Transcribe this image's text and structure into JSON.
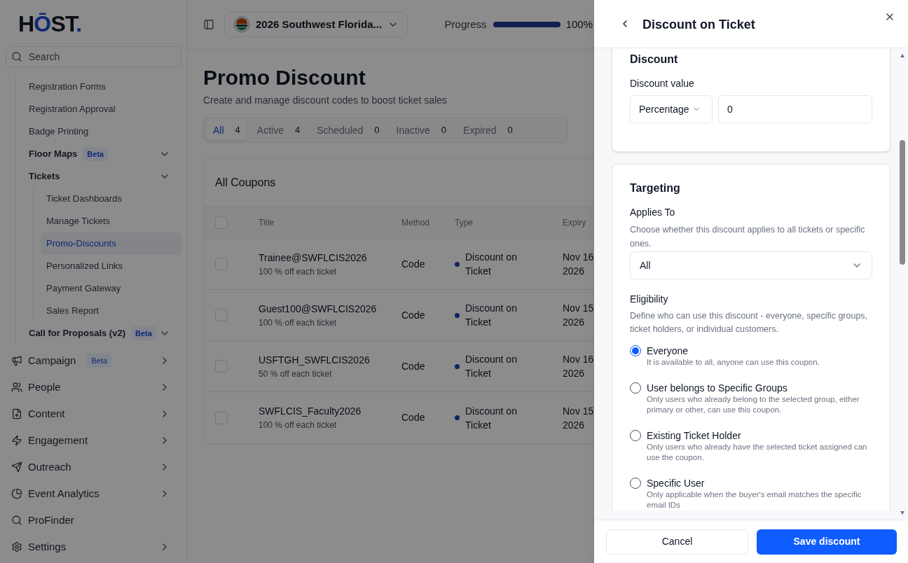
{
  "logo": [
    {
      "text": "H",
      "accent": false
    },
    {
      "text": "Ō",
      "accent": true
    },
    {
      "text": "ST",
      "accent": false
    },
    {
      "text": ".",
      "accent": true
    }
  ],
  "search": {
    "placeholder": "Search"
  },
  "sidebar": {
    "nested_items": [
      {
        "label": "Registration Forms",
        "selected": false
      },
      {
        "label": "Registration Approval",
        "selected": false
      },
      {
        "label": "Badge Printing",
        "selected": false
      },
      {
        "label": "Floor Maps",
        "badge": "Beta",
        "selected": false
      },
      {
        "label": "Tickets",
        "selected": false,
        "children": [
          {
            "label": "Ticket Dashboards",
            "selected": false
          },
          {
            "label": "Manage Tickets",
            "selected": false
          },
          {
            "label": "Promo-Discounts",
            "selected": true
          },
          {
            "label": "Personalized Links",
            "selected": false
          },
          {
            "label": "Payment Gateway",
            "selected": false
          },
          {
            "label": "Sales Report",
            "selected": false
          }
        ]
      },
      {
        "label": "Call for Proposals (v2)",
        "badge": "Beta",
        "selected": false
      }
    ],
    "items": [
      {
        "label": "Campaign",
        "badge": "Beta",
        "has_submenu": true,
        "selected": false
      },
      {
        "label": "People",
        "has_submenu": true,
        "selected": false
      },
      {
        "label": "Content",
        "has_submenu": true,
        "selected": false
      },
      {
        "label": "Engagement",
        "has_submenu": true,
        "selected": false
      },
      {
        "label": "Outreach",
        "has_submenu": true,
        "selected": false
      },
      {
        "label": "Event Analytics",
        "has_submenu": true,
        "selected": false
      },
      {
        "label": "ProFinder",
        "has_submenu": false,
        "selected": false
      },
      {
        "label": "Settings",
        "has_submenu": true,
        "selected": false
      }
    ]
  },
  "header": {
    "event": "2026 Southwest Florida...",
    "progress": {
      "label": "Progress",
      "level": 1,
      "reading": "100%"
    }
  },
  "page": {
    "title": "Promo Discount",
    "subtitle": "Create and manage discount codes to boost ticket sales"
  },
  "tabs": [
    {
      "label": "All",
      "count": "4",
      "selected": true
    },
    {
      "label": "Active",
      "count": "4",
      "selected": false
    },
    {
      "label": "Scheduled",
      "count": "0",
      "selected": false
    },
    {
      "label": "Inactive",
      "count": "0",
      "selected": false
    },
    {
      "label": "Expired",
      "count": "0",
      "selected": false
    }
  ],
  "table": {
    "title": "All Coupons",
    "all_checked": false,
    "columns": [
      "Title",
      "Method",
      "Type",
      "Expiry"
    ],
    "rows": [
      {
        "title": "Trainee@SWFLCIS2026",
        "subtitle": "100 % off each ticket",
        "method": "Code",
        "type": "Discount on Ticket",
        "expiry": "Nov 16 2026",
        "checked": false
      },
      {
        "title": "Guest100@SWFLCIS2026",
        "subtitle": "100 % off each ticket",
        "method": "Code",
        "type": "Discount on Ticket",
        "expiry": "Nov 15 2026",
        "checked": false
      },
      {
        "title": "USFTGH_SWFLCIS2026",
        "subtitle": "50 % off each ticket",
        "method": "Code",
        "type": "Discount on Ticket",
        "expiry": "Nov 16 2026",
        "checked": false
      },
      {
        "title": "SWFLCIS_Faculty2026",
        "subtitle": "100 % off each ticket",
        "method": "Code",
        "type": "Discount on Ticket",
        "expiry": "Nov 15 2026",
        "checked": false
      }
    ]
  },
  "drawer": {
    "title": "Discount on Ticket",
    "discount": {
      "heading": "Discount",
      "label": "Discount value",
      "type": "Percentage",
      "value": "0"
    },
    "targeting": {
      "heading": "Targeting",
      "applies_label": "Applies To",
      "applies_description": "Choose whether this discount applies to all tickets or specific ones.",
      "applies_value": "All",
      "eligibility_label": "Eligibility",
      "eligibility_description": "Define who can use this discount - everyone, specific groups, ticket holders, or individual customers.",
      "options": [
        {
          "label": "Everyone",
          "description": "It is available to all, anyone can use this coupon.",
          "selected": true
        },
        {
          "label": "User belongs to Specific Groups",
          "description": "Only users who already belong to the selected group, either primary or other, can use this coupon.",
          "selected": false
        },
        {
          "label": "Existing Ticket Holder",
          "description": "Only users who already have the selected ticket assigned can use the coupon.",
          "selected": false
        },
        {
          "label": "Specific User",
          "description": "Only applicable when the buyer's email matches the specific email IDs",
          "selected": false
        }
      ]
    },
    "buttons": {
      "cancel": "Cancel",
      "save": "Save discount"
    }
  }
}
